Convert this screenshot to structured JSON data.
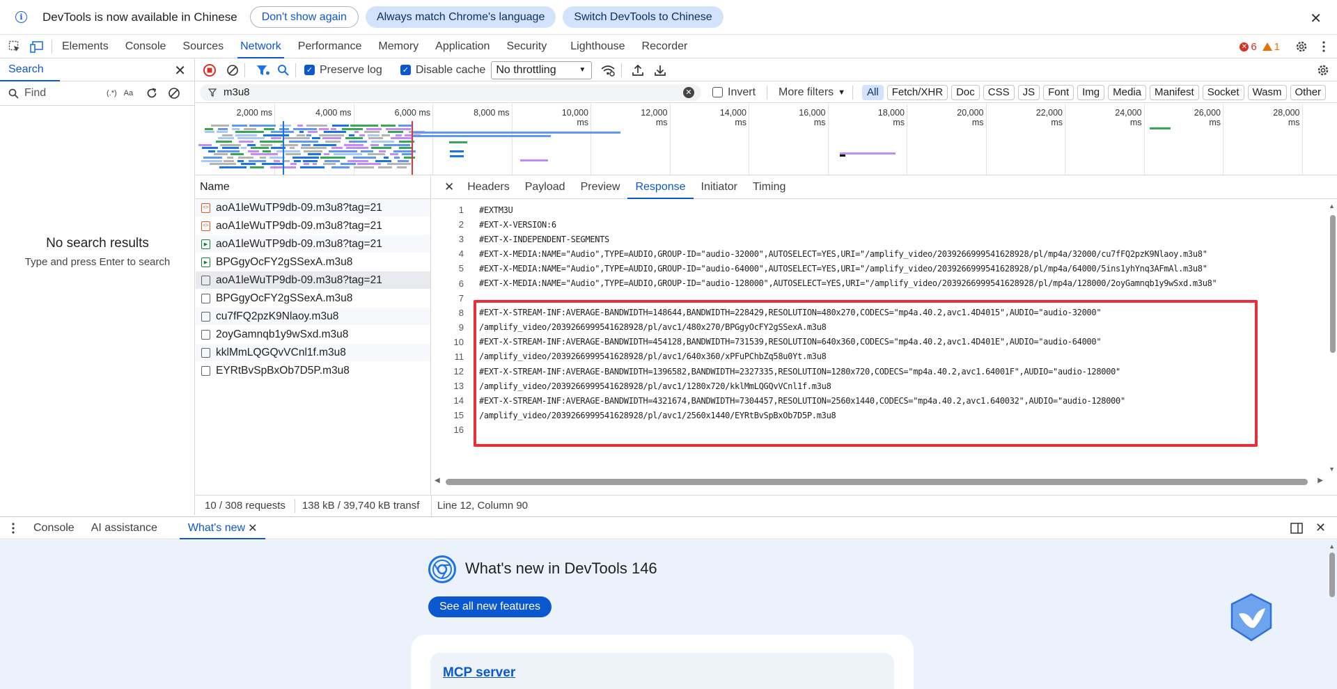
{
  "infobar": {
    "message": "DevTools is now available in Chinese",
    "btn_dont_show": "Don't show again",
    "btn_match_lang": "Always match Chrome's language",
    "btn_switch": "Switch DevTools to Chinese",
    "close": "✕"
  },
  "main_tabs": [
    "Elements",
    "Console",
    "Sources",
    "Network",
    "Performance",
    "Memory",
    "Application",
    "Security",
    "Lighthouse",
    "Recorder"
  ],
  "main_active": "Network",
  "badges": {
    "errors": "6",
    "warnings": "1"
  },
  "search_panel": {
    "tab": "Search",
    "find_placeholder": "Find",
    "regex": "(.*)",
    "case": "Aa",
    "no_results_title": "No search results",
    "no_results_sub": "Type and press Enter to search"
  },
  "network_toolbar": {
    "preserve_log": "Preserve log",
    "disable_cache": "Disable cache",
    "throttling": "No throttling"
  },
  "filter": {
    "value": "m3u8",
    "invert": "Invert",
    "more_filters": "More filters",
    "types": [
      "All",
      "Fetch/XHR",
      "Doc",
      "CSS",
      "JS",
      "Font",
      "Img",
      "Media",
      "Manifest",
      "Socket",
      "Wasm",
      "Other"
    ],
    "active_type": "All"
  },
  "timeline": {
    "ticks": [
      "2,000 ms",
      "4,000 ms",
      "6,000 ms",
      "8,000 ms",
      "10,000 ms",
      "12,000 ms",
      "14,000 ms",
      "16,000 ms",
      "18,000 ms",
      "20,000 ms",
      "22,000 ms",
      "24,000 ms",
      "26,000 ms",
      "28,000 ms"
    ]
  },
  "requests": {
    "header": "Name",
    "rows": [
      {
        "name": "aoA1leWuTP9db-09.m3u8?tag=21",
        "icon": "xhr"
      },
      {
        "name": "aoA1leWuTP9db-09.m3u8?tag=21",
        "icon": "xhr"
      },
      {
        "name": "aoA1leWuTP9db-09.m3u8?tag=21",
        "icon": "media"
      },
      {
        "name": "BPGgyOcFY2gSSexA.m3u8",
        "icon": "media"
      },
      {
        "name": "aoA1leWuTP9db-09.m3u8?tag=21",
        "icon": "doc",
        "selected": true
      },
      {
        "name": "BPGgyOcFY2gSSexA.m3u8",
        "icon": "doc"
      },
      {
        "name": "cu7fFQ2pzK9Nlaoy.m3u8",
        "icon": "doc"
      },
      {
        "name": "2oyGamnqb1y9wSxd.m3u8",
        "icon": "doc"
      },
      {
        "name": "kklMmLQGQvVCnl1f.m3u8",
        "icon": "doc"
      },
      {
        "name": "EYRtBvSpBxOb7D5P.m3u8",
        "icon": "doc"
      }
    ]
  },
  "detail": {
    "close": "✕",
    "tabs": [
      "Headers",
      "Payload",
      "Preview",
      "Response",
      "Initiator",
      "Timing"
    ],
    "active": "Response",
    "lines": [
      "#EXTM3U",
      "#EXT-X-VERSION:6",
      "#EXT-X-INDEPENDENT-SEGMENTS",
      "#EXT-X-MEDIA:NAME=\"Audio\",TYPE=AUDIO,GROUP-ID=\"audio-32000\",AUTOSELECT=YES,URI=\"/amplify_video/2039266999541628928/pl/mp4a/32000/cu7fFQ2pzK9Nlaoy.m3u8\"",
      "#EXT-X-MEDIA:NAME=\"Audio\",TYPE=AUDIO,GROUP-ID=\"audio-64000\",AUTOSELECT=YES,URI=\"/amplify_video/2039266999541628928/pl/mp4a/64000/5ins1yhYnq3AFmAl.m3u8\"",
      "#EXT-X-MEDIA:NAME=\"Audio\",TYPE=AUDIO,GROUP-ID=\"audio-128000\",AUTOSELECT=YES,URI=\"/amplify_video/2039266999541628928/pl/mp4a/128000/2oyGamnqb1y9wSxd.m3u8\"",
      "",
      "#EXT-X-STREAM-INF:AVERAGE-BANDWIDTH=148644,BANDWIDTH=228429,RESOLUTION=480x270,CODECS=\"mp4a.40.2,avc1.4D4015\",AUDIO=\"audio-32000\"",
      "/amplify_video/2039266999541628928/pl/avc1/480x270/BPGgyOcFY2gSSexA.m3u8",
      "#EXT-X-STREAM-INF:AVERAGE-BANDWIDTH=454128,BANDWIDTH=731539,RESOLUTION=640x360,CODECS=\"mp4a.40.2,avc1.4D401E\",AUDIO=\"audio-64000\"",
      "/amplify_video/2039266999541628928/pl/avc1/640x360/xPFuPChbZq58u0Yt.m3u8",
      "#EXT-X-STREAM-INF:AVERAGE-BANDWIDTH=1396582,BANDWIDTH=2327335,RESOLUTION=1280x720,CODECS=\"mp4a.40.2,avc1.64001F\",AUDIO=\"audio-128000\"",
      "/amplify_video/2039266999541628928/pl/avc1/1280x720/kklMmLQGQvVCnl1f.m3u8",
      "#EXT-X-STREAM-INF:AVERAGE-BANDWIDTH=4321674,BANDWIDTH=7304457,RESOLUTION=2560x1440,CODECS=\"mp4a.40.2,avc1.640032\",AUDIO=\"audio-128000\"",
      "/amplify_video/2039266999541628928/pl/avc1/2560x1440/EYRtBvSpBxOb7D5P.m3u8",
      ""
    ]
  },
  "status": {
    "requests": "10 / 308 requests",
    "transferred": "138 kB / 39,740 kB transf",
    "cursor": "Line 12, Column 90"
  },
  "drawer": {
    "tabs": [
      "Console",
      "AI assistance",
      "What's new"
    ],
    "active": "What's new"
  },
  "whats_new": {
    "title": "What's new in DevTools 146",
    "button": "See all new features",
    "card_title": "MCP server"
  }
}
